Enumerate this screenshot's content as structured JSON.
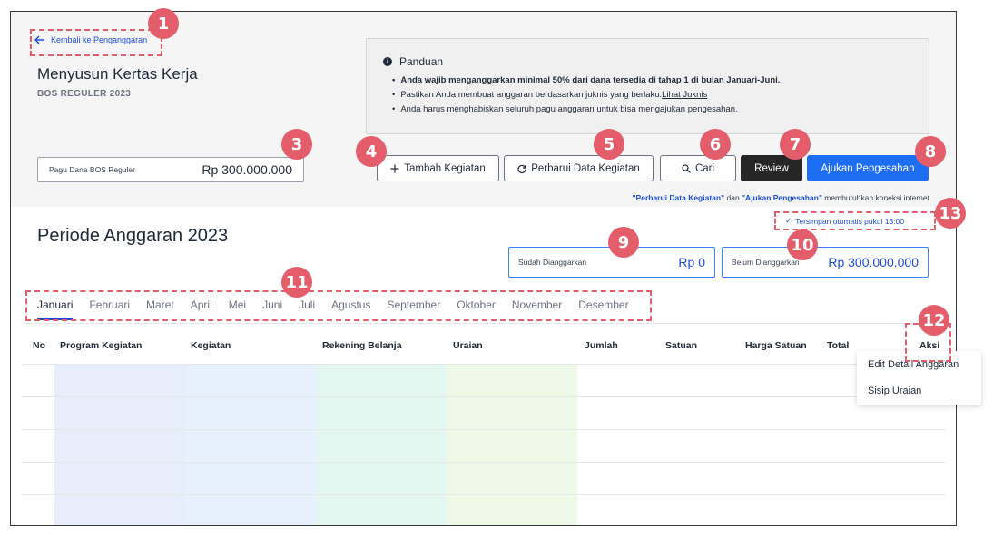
{
  "header": {
    "back_label": "Kembali ke Penganggaran",
    "title": "Menyusun Kertas Kerja",
    "subtitle": "BOS REGULER 2023"
  },
  "guide": {
    "title": "Panduan",
    "items": [
      "Anda wajib menganggarkan minimal 50% dari dana tersedia di tahap 1 di bulan Januari-Juni.",
      "Pastikan Anda membuat anggaran berdasarkan juknis yang berlaku.",
      "Anda harus menghabiskan seluruh pagu anggaran untuk bisa mengajukan pengesahan."
    ],
    "link_label": "Lihat Juknis"
  },
  "pagu": {
    "label": "Pagu Dana BOS Reguler",
    "value": "Rp 300.000.000"
  },
  "toolbar": {
    "tambah_label": "Tambah Kegiatan",
    "perbarui_label": "Perbarui Data Kegiatan",
    "cari_label": "Cari",
    "review_label": "Review",
    "ajukan_label": "Ajukan Pengesahan"
  },
  "notice": {
    "part1": "\"Perbarui Data Kegiatan\"",
    "part2": " dan ",
    "part3": "\"Ajukan Pengesahan\"",
    "part4": " membutuhkan koneksi internet"
  },
  "autosave": "Tersimpan otomatis pukul 13:00",
  "period_title": "Periode Anggaran 2023",
  "summary": {
    "sudah_label": "Sudah Dianggarkan",
    "sudah_value": "Rp 0",
    "belum_label": "Belum Dianggarkan",
    "belum_value": "Rp 300.000.000"
  },
  "months": [
    "Januari",
    "Februari",
    "Maret",
    "April",
    "Mei",
    "Juni",
    "Juli",
    "Agustus",
    "September",
    "Oktober",
    "November",
    "Desember"
  ],
  "active_month": "Januari",
  "table": {
    "headers": [
      "No",
      "Program Kegiatan",
      "Kegiatan",
      "Rekening Belanja",
      "Uraian",
      "Jumlah",
      "Satuan",
      "Harga Satuan",
      "Total",
      "Aksi"
    ]
  },
  "dropdown": {
    "items": [
      "Edit Detail Anggaran",
      "Sisip Uraian"
    ]
  },
  "annotations": [
    "1",
    "3",
    "4",
    "5",
    "6",
    "7",
    "8",
    "9",
    "10",
    "11",
    "12",
    "13"
  ],
  "colors": {
    "accent": "#1d6ef2",
    "annotation": "#e35d6a",
    "col_program": "#e8edfc",
    "col_kegiatan": "#e6f1fd",
    "col_rekening": "#e4f6f0",
    "col_uraian": "#eef8e6"
  }
}
